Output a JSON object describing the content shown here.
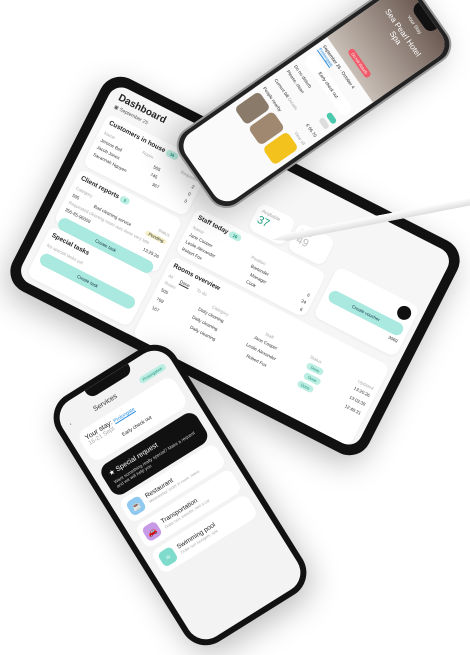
{
  "tablet": {
    "title": "Dashboard",
    "date": "September 25",
    "customers": {
      "title": "Customers in house",
      "count": "34",
      "col_name": "Name",
      "col_room": "Room",
      "col_requests": "Requests",
      "rows": [
        {
          "name": "Jerome Bell",
          "room": "505",
          "req": "2"
        },
        {
          "name": "Jacob Jones",
          "room": "745",
          "req": "0"
        },
        {
          "name": "Savannah Nguyen",
          "room": "367",
          "req": "0"
        }
      ]
    },
    "reports": {
      "title": "Client reports",
      "count": "3",
      "col_category": "Category",
      "col_status": "Status",
      "row_room": "505",
      "row_category": "Bad cleaning service",
      "row_desc": "Requested cleaning room was done very late",
      "status": "Pending",
      "phone": "356-85-96009",
      "time": "13:25:26",
      "create": "Create task"
    },
    "special": {
      "title": "Special tasks",
      "empty": "No special tasks yet",
      "create": "Create task"
    },
    "available": {
      "label": "Available",
      "value": "37"
    },
    "used": {
      "label": "Used",
      "value": "49"
    },
    "staff": {
      "title": "Staff today",
      "count": "26",
      "col_name": "Name",
      "col_position": "Position",
      "rows": [
        {
          "name": "Jane Cooper",
          "pos": "Bartender",
          "tasks": "6"
        },
        {
          "name": "Leslie Alexander",
          "pos": "Manager",
          "tasks": "24"
        },
        {
          "name": "Robert Fox",
          "pos": "Cook",
          "tasks": "6"
        }
      ]
    },
    "voucher": {
      "label": "Create voucher",
      "code": "3069"
    },
    "rooms": {
      "title": "Rooms overview",
      "tabs": [
        "All",
        "Done",
        "To do"
      ],
      "col_room": "Room",
      "col_category": "Category",
      "col_staff": "Staff",
      "col_status": "Status",
      "col_updated": "Updated",
      "rows": [
        {
          "room": "505",
          "cat": "Daily cleaning",
          "staff": "Jane Cooper",
          "status": "Done",
          "time": "13:20:26"
        },
        {
          "room": "769",
          "cat": "Daily cleaning",
          "staff": "Leslie Alexander",
          "status": "Done",
          "time": "13:03:38"
        },
        {
          "room": "167",
          "cat": "Daily cleaning",
          "staff": "Robert Fox",
          "status": "Done",
          "time": "12:48:31"
        }
      ]
    }
  },
  "phone_top": {
    "header": "Your Stay",
    "hotel": "Sea Pearl Hotel",
    "room": "Spa",
    "badge": "Do not disturb",
    "dates": "September 26 - October 4",
    "prolong": "Prolongate",
    "checkout": "Early check out",
    "dnd": "Do no disturb",
    "clean": "Please, clean",
    "bill_label": "Current bill",
    "bill_sub": "Details",
    "bill": "€ 66.70",
    "people": "People nearby",
    "view_all": "View all"
  },
  "phone_bottom": {
    "title": "Services",
    "badge": "Prolongation",
    "stay_label": "Your stay:",
    "stay_dates": "16-21 Sept",
    "prolong": "Prolongate",
    "checkout": "Early check out",
    "special_title": "Special request",
    "special_desc": "Want something really special? Make a request and we will help you",
    "services": [
      {
        "name": "Restaurant",
        "desc": "Wednesday, order in room, menu",
        "color": "#8fc9f0",
        "icon": "☕"
      },
      {
        "name": "Transportation",
        "desc": "Order taxi, transfer, rent a car",
        "color": "#c79ae8",
        "icon": "🚗"
      },
      {
        "name": "Swimming pool",
        "desc": "Order sun loungers, spa",
        "color": "#7fdccc",
        "icon": "≈"
      }
    ]
  }
}
